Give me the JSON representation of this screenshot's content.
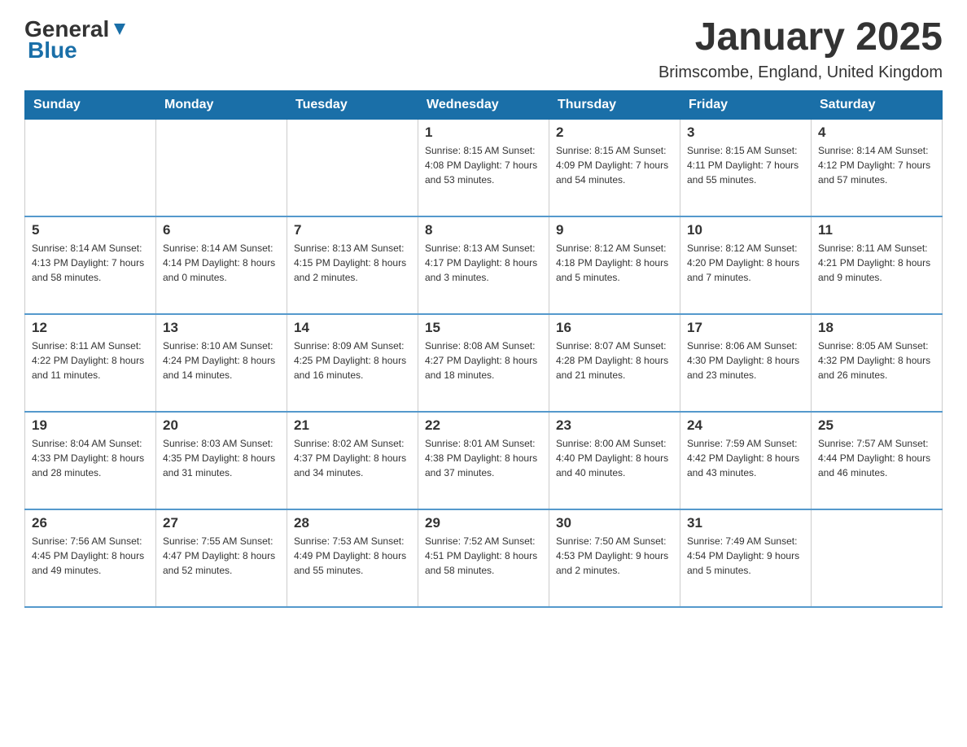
{
  "header": {
    "logo": {
      "text_general": "General",
      "text_blue": "Blue"
    },
    "month_title": "January 2025",
    "subtitle": "Brimscombe, England, United Kingdom"
  },
  "days_of_week": [
    "Sunday",
    "Monday",
    "Tuesday",
    "Wednesday",
    "Thursday",
    "Friday",
    "Saturday"
  ],
  "weeks": [
    [
      {
        "day": "",
        "info": ""
      },
      {
        "day": "",
        "info": ""
      },
      {
        "day": "",
        "info": ""
      },
      {
        "day": "1",
        "info": "Sunrise: 8:15 AM\nSunset: 4:08 PM\nDaylight: 7 hours\nand 53 minutes."
      },
      {
        "day": "2",
        "info": "Sunrise: 8:15 AM\nSunset: 4:09 PM\nDaylight: 7 hours\nand 54 minutes."
      },
      {
        "day": "3",
        "info": "Sunrise: 8:15 AM\nSunset: 4:11 PM\nDaylight: 7 hours\nand 55 minutes."
      },
      {
        "day": "4",
        "info": "Sunrise: 8:14 AM\nSunset: 4:12 PM\nDaylight: 7 hours\nand 57 minutes."
      }
    ],
    [
      {
        "day": "5",
        "info": "Sunrise: 8:14 AM\nSunset: 4:13 PM\nDaylight: 7 hours\nand 58 minutes."
      },
      {
        "day": "6",
        "info": "Sunrise: 8:14 AM\nSunset: 4:14 PM\nDaylight: 8 hours\nand 0 minutes."
      },
      {
        "day": "7",
        "info": "Sunrise: 8:13 AM\nSunset: 4:15 PM\nDaylight: 8 hours\nand 2 minutes."
      },
      {
        "day": "8",
        "info": "Sunrise: 8:13 AM\nSunset: 4:17 PM\nDaylight: 8 hours\nand 3 minutes."
      },
      {
        "day": "9",
        "info": "Sunrise: 8:12 AM\nSunset: 4:18 PM\nDaylight: 8 hours\nand 5 minutes."
      },
      {
        "day": "10",
        "info": "Sunrise: 8:12 AM\nSunset: 4:20 PM\nDaylight: 8 hours\nand 7 minutes."
      },
      {
        "day": "11",
        "info": "Sunrise: 8:11 AM\nSunset: 4:21 PM\nDaylight: 8 hours\nand 9 minutes."
      }
    ],
    [
      {
        "day": "12",
        "info": "Sunrise: 8:11 AM\nSunset: 4:22 PM\nDaylight: 8 hours\nand 11 minutes."
      },
      {
        "day": "13",
        "info": "Sunrise: 8:10 AM\nSunset: 4:24 PM\nDaylight: 8 hours\nand 14 minutes."
      },
      {
        "day": "14",
        "info": "Sunrise: 8:09 AM\nSunset: 4:25 PM\nDaylight: 8 hours\nand 16 minutes."
      },
      {
        "day": "15",
        "info": "Sunrise: 8:08 AM\nSunset: 4:27 PM\nDaylight: 8 hours\nand 18 minutes."
      },
      {
        "day": "16",
        "info": "Sunrise: 8:07 AM\nSunset: 4:28 PM\nDaylight: 8 hours\nand 21 minutes."
      },
      {
        "day": "17",
        "info": "Sunrise: 8:06 AM\nSunset: 4:30 PM\nDaylight: 8 hours\nand 23 minutes."
      },
      {
        "day": "18",
        "info": "Sunrise: 8:05 AM\nSunset: 4:32 PM\nDaylight: 8 hours\nand 26 minutes."
      }
    ],
    [
      {
        "day": "19",
        "info": "Sunrise: 8:04 AM\nSunset: 4:33 PM\nDaylight: 8 hours\nand 28 minutes."
      },
      {
        "day": "20",
        "info": "Sunrise: 8:03 AM\nSunset: 4:35 PM\nDaylight: 8 hours\nand 31 minutes."
      },
      {
        "day": "21",
        "info": "Sunrise: 8:02 AM\nSunset: 4:37 PM\nDaylight: 8 hours\nand 34 minutes."
      },
      {
        "day": "22",
        "info": "Sunrise: 8:01 AM\nSunset: 4:38 PM\nDaylight: 8 hours\nand 37 minutes."
      },
      {
        "day": "23",
        "info": "Sunrise: 8:00 AM\nSunset: 4:40 PM\nDaylight: 8 hours\nand 40 minutes."
      },
      {
        "day": "24",
        "info": "Sunrise: 7:59 AM\nSunset: 4:42 PM\nDaylight: 8 hours\nand 43 minutes."
      },
      {
        "day": "25",
        "info": "Sunrise: 7:57 AM\nSunset: 4:44 PM\nDaylight: 8 hours\nand 46 minutes."
      }
    ],
    [
      {
        "day": "26",
        "info": "Sunrise: 7:56 AM\nSunset: 4:45 PM\nDaylight: 8 hours\nand 49 minutes."
      },
      {
        "day": "27",
        "info": "Sunrise: 7:55 AM\nSunset: 4:47 PM\nDaylight: 8 hours\nand 52 minutes."
      },
      {
        "day": "28",
        "info": "Sunrise: 7:53 AM\nSunset: 4:49 PM\nDaylight: 8 hours\nand 55 minutes."
      },
      {
        "day": "29",
        "info": "Sunrise: 7:52 AM\nSunset: 4:51 PM\nDaylight: 8 hours\nand 58 minutes."
      },
      {
        "day": "30",
        "info": "Sunrise: 7:50 AM\nSunset: 4:53 PM\nDaylight: 9 hours\nand 2 minutes."
      },
      {
        "day": "31",
        "info": "Sunrise: 7:49 AM\nSunset: 4:54 PM\nDaylight: 9 hours\nand 5 minutes."
      },
      {
        "day": "",
        "info": ""
      }
    ]
  ]
}
